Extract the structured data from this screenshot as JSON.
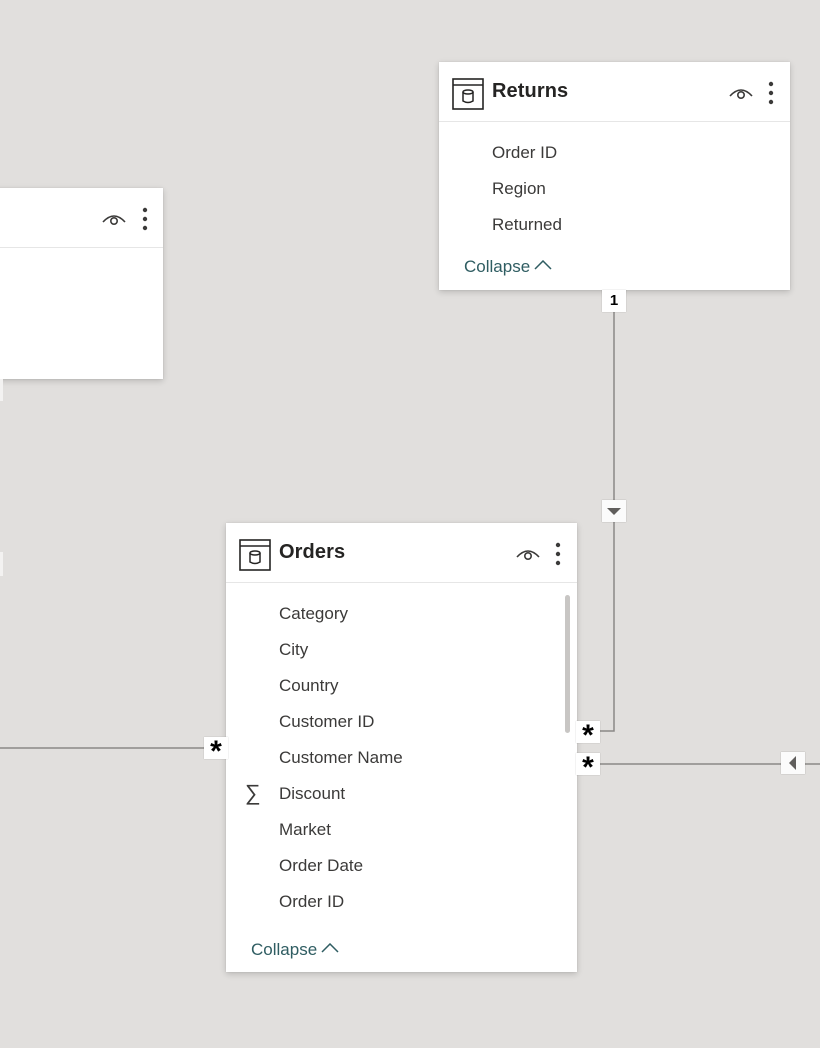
{
  "tables": {
    "returns": {
      "title": "Returns",
      "fields": [
        "Order ID",
        "Region",
        "Returned"
      ],
      "collapse_label": "Collapse"
    },
    "orders": {
      "title": "Orders",
      "fields": [
        {
          "name": "Category",
          "icon": ""
        },
        {
          "name": "City",
          "icon": ""
        },
        {
          "name": "Country",
          "icon": ""
        },
        {
          "name": "Customer ID",
          "icon": ""
        },
        {
          "name": "Customer Name",
          "icon": ""
        },
        {
          "name": "Discount",
          "icon": "sigma"
        },
        {
          "name": "Market",
          "icon": ""
        },
        {
          "name": "Order Date",
          "icon": ""
        },
        {
          "name": "Order ID",
          "icon": ""
        }
      ],
      "collapse_label": "Collapse"
    }
  },
  "relationships": {
    "returns_orders": {
      "one_side": "1",
      "many_side": "*"
    },
    "orders_left": {
      "many_side": "*"
    },
    "orders_right": {
      "many_side": "*"
    }
  },
  "sigma_glyph": "∑",
  "colors": {
    "canvas": "#e1dfdd",
    "card": "#ffffff",
    "connector": "#8a8886",
    "collapse_text": "#2f5d62"
  }
}
